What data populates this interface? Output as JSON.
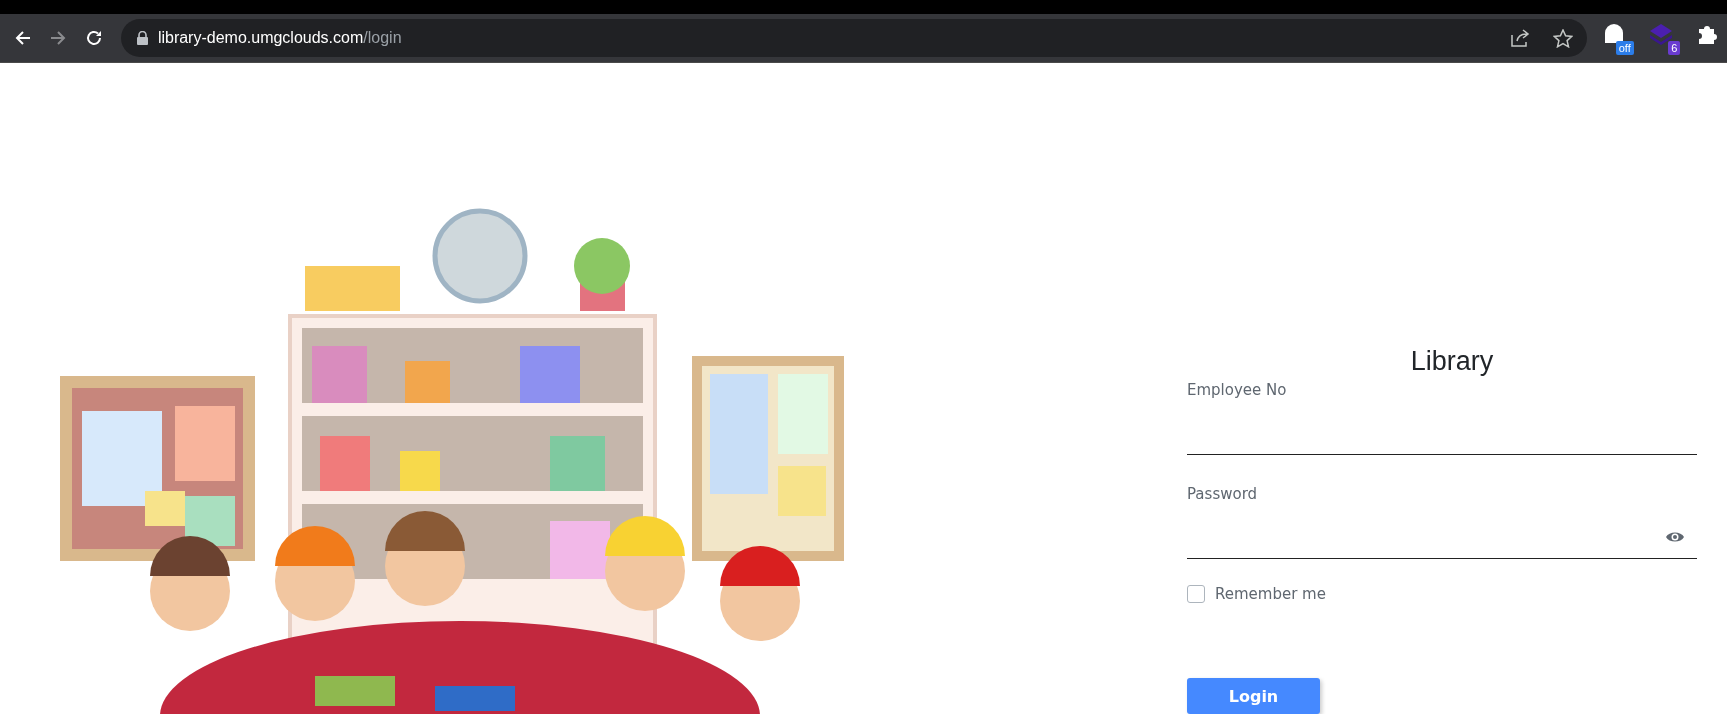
{
  "browser": {
    "url_host": "library-demo.umgclouds.com",
    "url_path": "/login",
    "extensions": [
      {
        "kind": "ghost",
        "badge": "off"
      },
      {
        "kind": "layers",
        "badge": "6"
      },
      {
        "kind": "puzzle"
      }
    ]
  },
  "login": {
    "title": "Library",
    "fields": [
      {
        "label": "Employee No",
        "kind": "text"
      },
      {
        "label": "Password",
        "kind": "password"
      }
    ],
    "remember": {
      "label": "Remember me",
      "checked": false
    },
    "button": "Login"
  }
}
